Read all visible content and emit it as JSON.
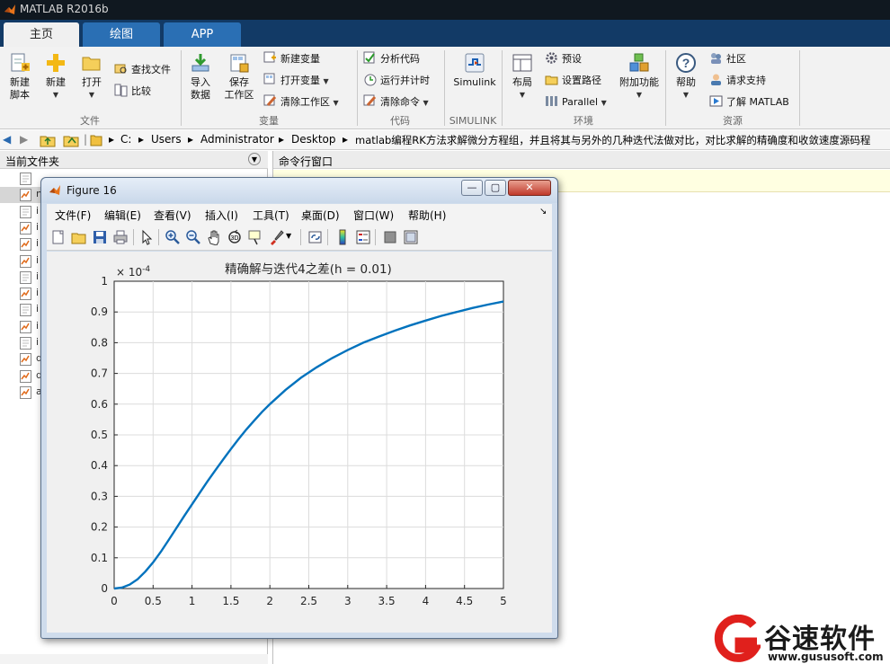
{
  "window": {
    "title": "MATLAB R2016b"
  },
  "tabs": [
    {
      "label": "主页",
      "active": true
    },
    {
      "label": "绘图",
      "active": false
    },
    {
      "label": "APP",
      "active": false
    }
  ],
  "ribbon": {
    "file": {
      "new_script_l1": "新建",
      "new_script_l2": "脚本",
      "new": "新建",
      "open": "打开",
      "find_files": "查找文件",
      "compare": "比较",
      "group": "文件"
    },
    "variable": {
      "import_l1": "导入",
      "import_l2": "数据",
      "save_l1": "保存",
      "save_l2": "工作区",
      "new_var": "新建变量",
      "open_var": "打开变量",
      "clear_ws": "清除工作区",
      "group": "变量"
    },
    "code": {
      "analyze": "分析代码",
      "run_time": "运行并计时",
      "clear_cmd": "清除命令",
      "group": "代码"
    },
    "simulink": {
      "label": "Simulink",
      "group": "SIMULINK"
    },
    "environment": {
      "layout": "布局",
      "prefs": "预设",
      "set_path": "设置路径",
      "parallel": "Parallel",
      "addons": "附加功能",
      "group": "环境"
    },
    "resources": {
      "help": "帮助",
      "community": "社区",
      "request_support": "请求支持",
      "learn": "了解 MATLAB",
      "group": "资源"
    }
  },
  "address": {
    "segments": [
      "C:",
      "Users",
      "Administrator",
      "Desktop",
      "matlab编程RK方法求解微分方程组，并且将其与另外的几种迭代法做对比，对比求解的精确度和收敛速度源码程"
    ]
  },
  "left_pane": {
    "title": "当前文件夹",
    "files": [
      "",
      "n",
      "i",
      "i",
      "i",
      "i",
      "i",
      "i",
      "i",
      "i",
      "i",
      "d",
      "d",
      "a"
    ]
  },
  "command_pane": {
    "title": "命令行窗口"
  },
  "figure": {
    "title": "Figure 16",
    "menu": [
      "文件(F)",
      "编辑(E)",
      "查看(V)",
      "插入(I)",
      "工具(T)",
      "桌面(D)",
      "窗口(W)",
      "帮助(H)"
    ],
    "window_buttons": {
      "minimize": "—",
      "restore": "▢",
      "close": "✕"
    }
  },
  "chart_data": {
    "type": "line",
    "title": "精确解与迭代4之差(h = 0.01)",
    "xlabel": "",
    "ylabel": "",
    "y_multiplier": "× 10",
    "y_multiplier_exp": "-4",
    "xlim": [
      0,
      5
    ],
    "ylim": [
      0,
      1
    ],
    "grid": true,
    "x_ticks": [
      "0",
      "0.5",
      "1",
      "1.5",
      "2",
      "2.5",
      "3",
      "3.5",
      "4",
      "4.5",
      "5"
    ],
    "y_ticks": [
      "0",
      "0.1",
      "0.2",
      "0.3",
      "0.4",
      "0.5",
      "0.6",
      "0.7",
      "0.8",
      "0.9",
      "1"
    ],
    "series": [
      {
        "color": "#0072bd",
        "x": [
          0,
          0.1,
          0.2,
          0.3,
          0.4,
          0.5,
          0.6,
          0.7,
          0.8,
          0.9,
          1.0,
          1.1,
          1.2,
          1.3,
          1.4,
          1.5,
          1.6,
          1.7,
          1.8,
          1.9,
          2.0,
          2.2,
          2.4,
          2.6,
          2.8,
          3.0,
          3.2,
          3.4,
          3.6,
          3.8,
          4.0,
          4.2,
          4.4,
          4.6,
          4.8,
          5.0
        ],
        "y": [
          0,
          0.003,
          0.013,
          0.03,
          0.055,
          0.085,
          0.12,
          0.158,
          0.197,
          0.236,
          0.274,
          0.312,
          0.349,
          0.385,
          0.42,
          0.454,
          0.487,
          0.518,
          0.547,
          0.575,
          0.6,
          0.646,
          0.686,
          0.72,
          0.75,
          0.776,
          0.8,
          0.82,
          0.839,
          0.856,
          0.872,
          0.887,
          0.9,
          0.913,
          0.924,
          0.934
        ]
      }
    ]
  },
  "watermark": {
    "brand": "谷速软件",
    "url": "www.gususoft.com",
    "color": "#e0201c"
  }
}
